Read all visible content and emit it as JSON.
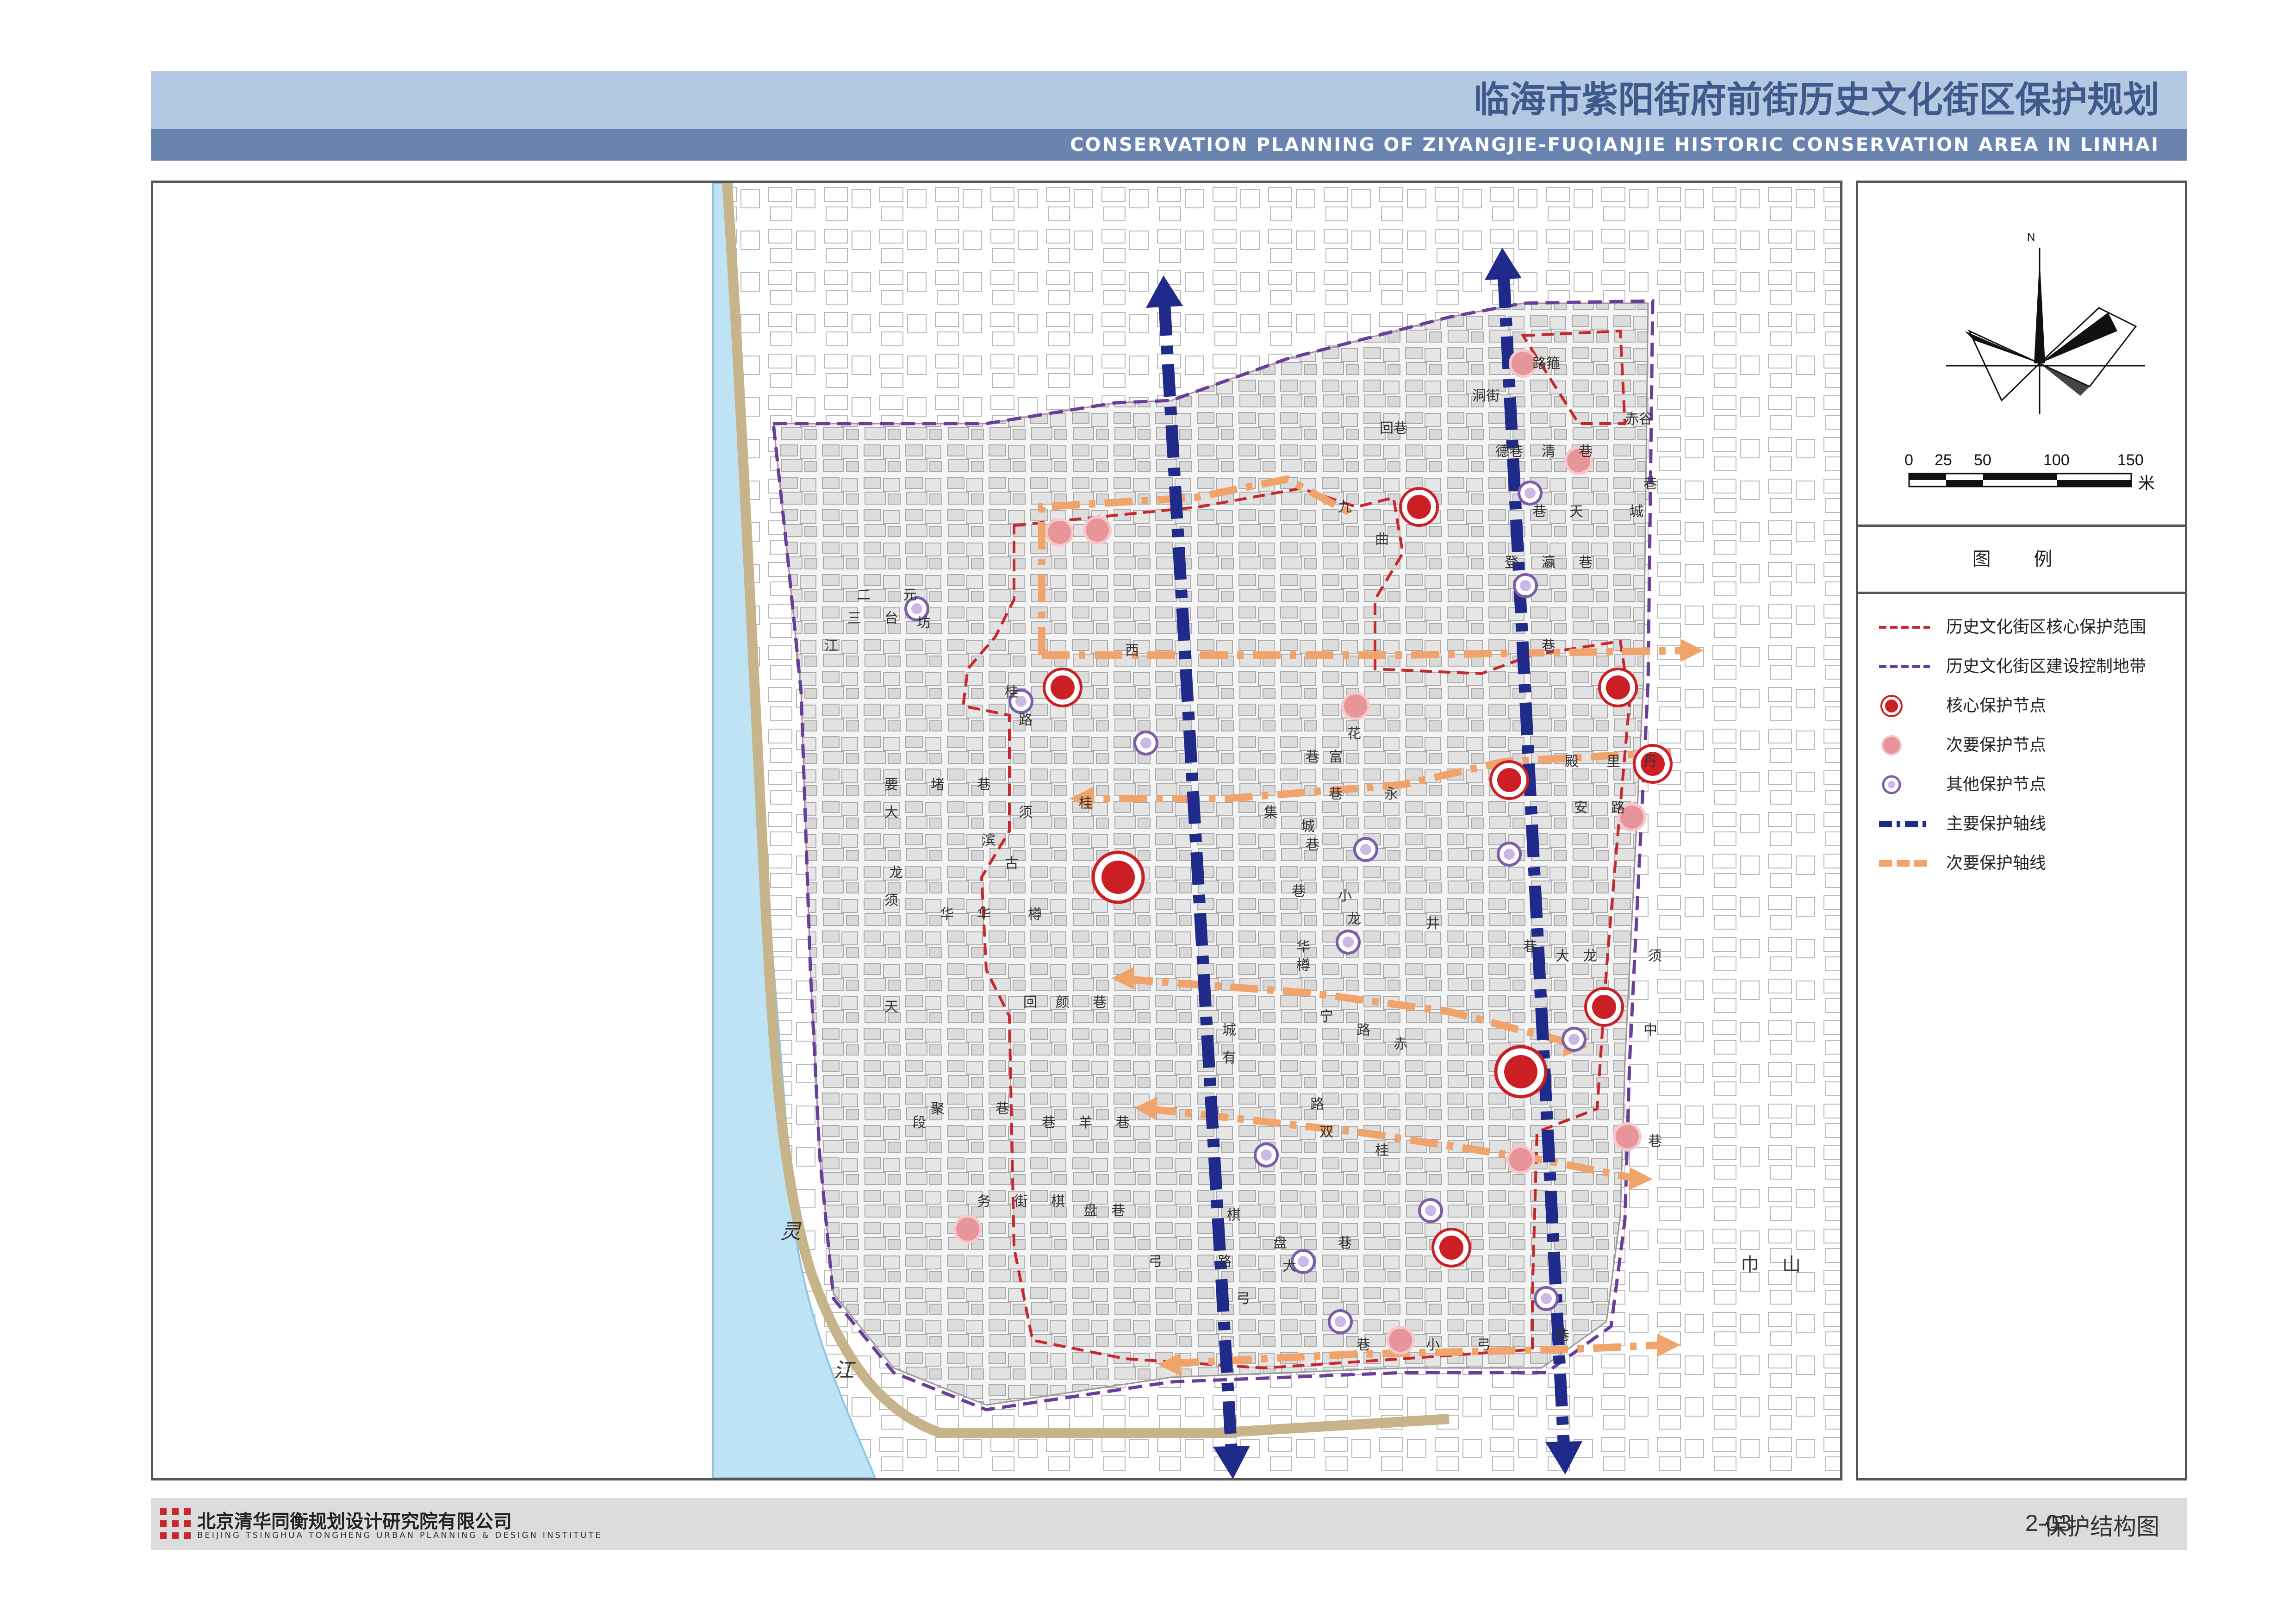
{
  "header": {
    "title_cn": "临海市紫阳街府前街历史文化街区保护规划",
    "title_en": "CONSERVATION PLANNING OF ZIYANGJIE-FUQIANJIE  HISTORIC CONSERVATION AREA IN LINHAI"
  },
  "compass": {
    "north_label": "N"
  },
  "scale_bar": {
    "ticks": [
      "0",
      "25",
      "50",
      "100",
      "150"
    ],
    "unit": "米"
  },
  "legend": {
    "title": "图 例",
    "items": [
      {
        "label": "历史文化街区核心保护范围",
        "symbol": "red-dashed-line",
        "color": "#c8282d"
      },
      {
        "label": "历史文化街区建设控制地带",
        "symbol": "purple-dashed-line",
        "color": "#6a3d9a"
      },
      {
        "label": "核心保护节点",
        "symbol": "red-solid-dot",
        "color": "#cc1f24"
      },
      {
        "label": "次要保护节点",
        "symbol": "pink-dot",
        "color": "#e8959a"
      },
      {
        "label": "其他保护节点",
        "symbol": "purple-ring",
        "color": "#7b5ea7"
      },
      {
        "label": "主要保护轴线",
        "symbol": "blue-dashdot-line",
        "color": "#1f2a8a"
      },
      {
        "label": "次要保护轴线",
        "symbol": "orange-dashed-line",
        "color": "#f0a36a"
      }
    ]
  },
  "map_labels": {
    "river": [
      "灵",
      "江"
    ],
    "mountain": [
      "巾",
      "山"
    ],
    "streets": [
      "路",
      "洞",
      "回",
      "赤",
      "德",
      "清",
      "巷",
      "九",
      "曲",
      "巷",
      "天",
      "巷",
      "城",
      "二",
      "元",
      "登",
      "瀛",
      "巷",
      "三",
      "台",
      "坊",
      "江",
      "桂",
      "巷",
      "西",
      "路",
      "花",
      "巷",
      "富",
      "殿",
      "里",
      "丹",
      "桂",
      "巷",
      "永",
      "安",
      "路",
      "要",
      "堵",
      "巷",
      "集",
      "城",
      "巷",
      "大",
      "龙",
      "须",
      "滨",
      "古",
      "华",
      "华",
      "樽",
      "巷",
      "小",
      "龙",
      "须",
      "井",
      "华",
      "樽",
      "巷",
      "大",
      "龙",
      "须",
      "天",
      "宁",
      "路",
      "赤",
      "中",
      "回",
      "颜",
      "巷",
      "城",
      "有",
      "聚",
      "巷",
      "段",
      "巷",
      "羊",
      "巷",
      "路",
      "双",
      "桂",
      "巷",
      "务",
      "街",
      "棋",
      "盘",
      "巷",
      "棋",
      "盘",
      "巷",
      "弓",
      "路",
      "大",
      "弓",
      "巷",
      "小",
      "弓",
      "巷",
      "箍",
      "街",
      "巷",
      "谷",
      "巷"
    ]
  },
  "footer": {
    "company_cn": "北京清华同衡规划设计研究院有限公司",
    "company_en": "BEIJING TSINGHUA TONGHENG URBAN PLANNING & DESIGN INSTITUTE",
    "sheet_no": "2-03",
    "sheet_name": "保护结构图"
  }
}
